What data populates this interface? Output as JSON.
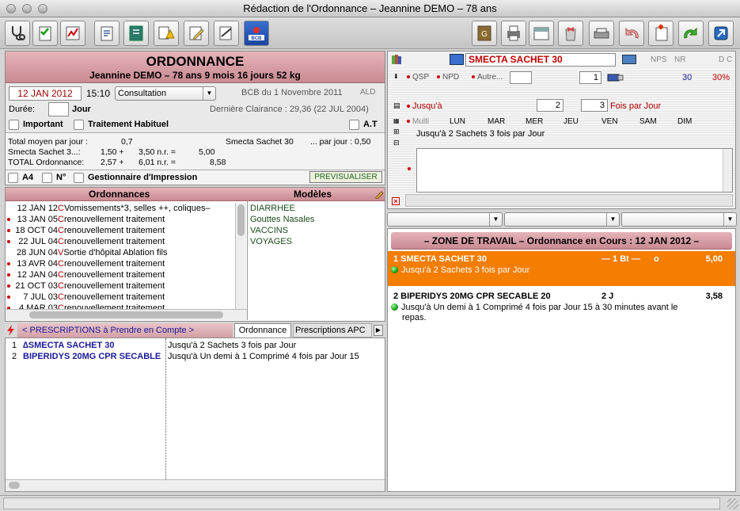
{
  "window": {
    "title": "Rédaction de l'Ordonnance – Jeannine DEMO – 78 ans"
  },
  "ordonnance": {
    "title": "ORDONNANCE",
    "patient_line": "Jeannine DEMO – 78 ans 9 mois 16 jours  52 kg",
    "date": "12 JAN 2012",
    "time": "15:10",
    "type": "Consultation",
    "bcb": "BCB du 1 Novembre 2011",
    "ald": "ALD",
    "duree_label": "Durée:",
    "duree_value": "",
    "jour_label": "Jour",
    "clairance": "Dernière Clairance : 29,36 (22 JUL 2004)",
    "important": "Important",
    "traitement": "Traitement Habituel",
    "at": "A.T",
    "total_moyen_label": "Total moyen par jour   :",
    "total_moyen_value": "0,7",
    "smecta_right": "Smecta Sachet 30",
    "par_jour": "... par jour : 0,50",
    "line2_label": "Smecta Sachet 3...:",
    "line2_a": "1,50 +",
    "line2_b": "3,50 n.r. =",
    "line2_c": "5,00",
    "line3_label": "TOTAL Ordonnance:",
    "line3_a": "2,57 +",
    "line3_b": "6,01 n.r. =",
    "line3_c": "8,58",
    "a4": "A4",
    "num": "N°",
    "gestionnaire": "Gestionnaire d'Impression",
    "previsualiser": "PREVISUALISER"
  },
  "history": {
    "col1": "Ordonnances",
    "col2": "Modèles",
    "items": [
      {
        "date": "12 JAN 12",
        "t": "C",
        "text": "Vomissements*3, selles ++, coliques–",
        "dot": false
      },
      {
        "date": "13 JAN 05",
        "t": "C",
        "text": "renouvellement traitement",
        "dot": true
      },
      {
        "date": "18 OCT 04",
        "t": "C",
        "text": "renouvellement traitement",
        "dot": true
      },
      {
        "date": "22 JUL 04",
        "t": "C",
        "text": "renouvellement traitement",
        "dot": true
      },
      {
        "date": "28 JUN 04",
        "t": "V",
        "text": "Sortie d'hôpital Ablation fils",
        "dot": false
      },
      {
        "date": "13 AVR 04",
        "t": "C",
        "text": "renouvellement traitement",
        "dot": true
      },
      {
        "date": "12 JAN 04",
        "t": "C",
        "text": "renouvellement traitement",
        "dot": true
      },
      {
        "date": "21 OCT 03",
        "t": "C",
        "text": "renouvellement traitement",
        "dot": true
      },
      {
        "date": "7 JUL 03",
        "t": "C",
        "text": "renouvellement traitement",
        "dot": true
      },
      {
        "date": "4 MAR 03",
        "t": "C",
        "text": "renouvellement traitement",
        "dot": true
      }
    ],
    "models": [
      "DIARRHEE",
      "Gouttes Nasales",
      "VACCINS",
      "VOYAGES"
    ]
  },
  "tabs": {
    "prescriptions": "< PRESCRIPTIONS à Prendre en Compte >",
    "ordonnance": "Ordonnance",
    "apc": "Prescriptions APC"
  },
  "prescriptions": [
    {
      "num": "1",
      "name": "∆SMECTA SACHET 30",
      "pos": "Jusqu'à 2 Sachets 3 fois par Jour"
    },
    {
      "num": "2",
      "name": "BIPERIDYS 20MG CPR SECABLE",
      "pos": "Jusqu'à Un demi à 1 Comprimé 4 fois par Jour 15"
    }
  ],
  "editor": {
    "drug": "SMECTA SACHET 30",
    "nps": "NPS",
    "nr": "NR",
    "dc": "D C",
    "qsp": "QSP",
    "npd": "NPD",
    "autre": "Autre...",
    "qty": "1",
    "val30": "30",
    "pct": "30%",
    "jusqua": "Jusqu'à",
    "n1": "2",
    "n2": "3",
    "fois": "Fois par Jour",
    "multi": "Multi",
    "days": [
      "LUN",
      "MAR",
      "MER",
      "JEU",
      "VEN",
      "SAM",
      "DIM"
    ],
    "summary": "Jusqu'à 2 Sachets 3 fois par Jour"
  },
  "zone": {
    "title": "– ZONE DE TRAVAIL – Ordonnance en Cours : 12 JAN 2012 –",
    "items": [
      {
        "head": "1 SMECTA SACHET 30",
        "qty": "— 1 Bt —",
        "o": "o",
        "price": "5,00",
        "pos": "Jusqu'à 2 Sachets 3 fois par Jour",
        "selected": true
      },
      {
        "head": "2 BIPERIDYS 20MG CPR SECABLE 20",
        "qty": "2 J",
        "o": "",
        "price": "3,58",
        "pos": "Jusqu'à Un demi à 1 Comprimé 4 fois par Jour 15 à 30 minutes avant le",
        "pos2": "repas.",
        "selected": false
      }
    ]
  },
  "colors": {
    "accent_orange": "#f57d00",
    "header_pink": "#d49aa1",
    "drug_red": "#c00000",
    "blue_text": "#1a1a9a"
  }
}
